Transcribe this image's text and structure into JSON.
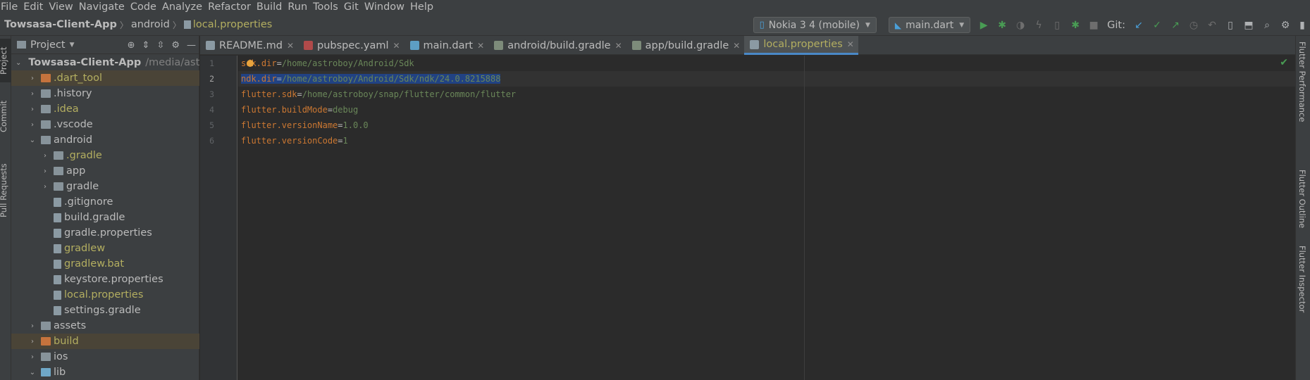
{
  "menu": [
    "File",
    "Edit",
    "View",
    "Navigate",
    "Code",
    "Analyze",
    "Refactor",
    "Build",
    "Run",
    "Tools",
    "Git",
    "Window",
    "Help"
  ],
  "breadcrumb": {
    "project": "Towsasa-Client-App",
    "folder": "android",
    "file": "local.properties"
  },
  "toolbar": {
    "device": "Nokia 3 4 (mobile)",
    "run_config": "main.dart",
    "git_label": "Git:"
  },
  "side_tabs_left": [
    "Project",
    "Commit",
    "Pull Requests"
  ],
  "side_tabs_right": [
    "Flutter Performance",
    "Flutter Outline",
    "Flutter Inspector"
  ],
  "project_panel": {
    "title": "Project"
  },
  "tree": [
    {
      "label": "Towsasa-Client-App",
      "path": "/media/ast",
      "bold": true
    },
    {
      "label": ".dart_tool",
      "color": "yellow",
      "highlight": true
    },
    {
      "label": ".history"
    },
    {
      "label": ".idea",
      "color": "yellow"
    },
    {
      "label": ".vscode"
    },
    {
      "label": "android"
    },
    {
      "label": ".gradle",
      "color": "yellow"
    },
    {
      "label": "app"
    },
    {
      "label": "gradle"
    },
    {
      "label": ".gitignore"
    },
    {
      "label": "build.gradle"
    },
    {
      "label": "gradle.properties"
    },
    {
      "label": "gradlew",
      "color": "yellow"
    },
    {
      "label": "gradlew.bat",
      "color": "yellow"
    },
    {
      "label": "keystore.properties"
    },
    {
      "label": "local.properties",
      "color": "yellow"
    },
    {
      "label": "settings.gradle"
    },
    {
      "label": "assets"
    },
    {
      "label": "build",
      "color": "yellow",
      "highlight": true
    },
    {
      "label": "ios"
    },
    {
      "label": "lib"
    }
  ],
  "tabs": [
    {
      "label": "README.md"
    },
    {
      "label": "pubspec.yaml"
    },
    {
      "label": "main.dart"
    },
    {
      "label": "android/build.gradle"
    },
    {
      "label": "app/build.gradle"
    },
    {
      "label": "local.properties",
      "active": true
    }
  ],
  "editor": {
    "lines": [
      {
        "n": "1",
        "key": "sdk.dir",
        "value": "/home/astroboy/Android/Sdk"
      },
      {
        "n": "2",
        "key": "ndk.dir",
        "value": "/home/astroboy/Android/Sdk/ndk/24.0.8215888"
      },
      {
        "n": "3",
        "key": "flutter.sdk",
        "value": "/home/astroboy/snap/flutter/common/flutter"
      },
      {
        "n": "4",
        "key": "flutter.buildMode",
        "value": "debug"
      },
      {
        "n": "5",
        "key": "flutter.versionName",
        "value": "1.0.0"
      },
      {
        "n": "6",
        "key": "flutter.versionCode",
        "value": "1"
      }
    ]
  },
  "colors": {
    "accent": "#4a88c7",
    "modified_file": "#b3ae60",
    "property_key": "#cc7832",
    "property_value": "#6a8759",
    "selection": "#214283"
  }
}
